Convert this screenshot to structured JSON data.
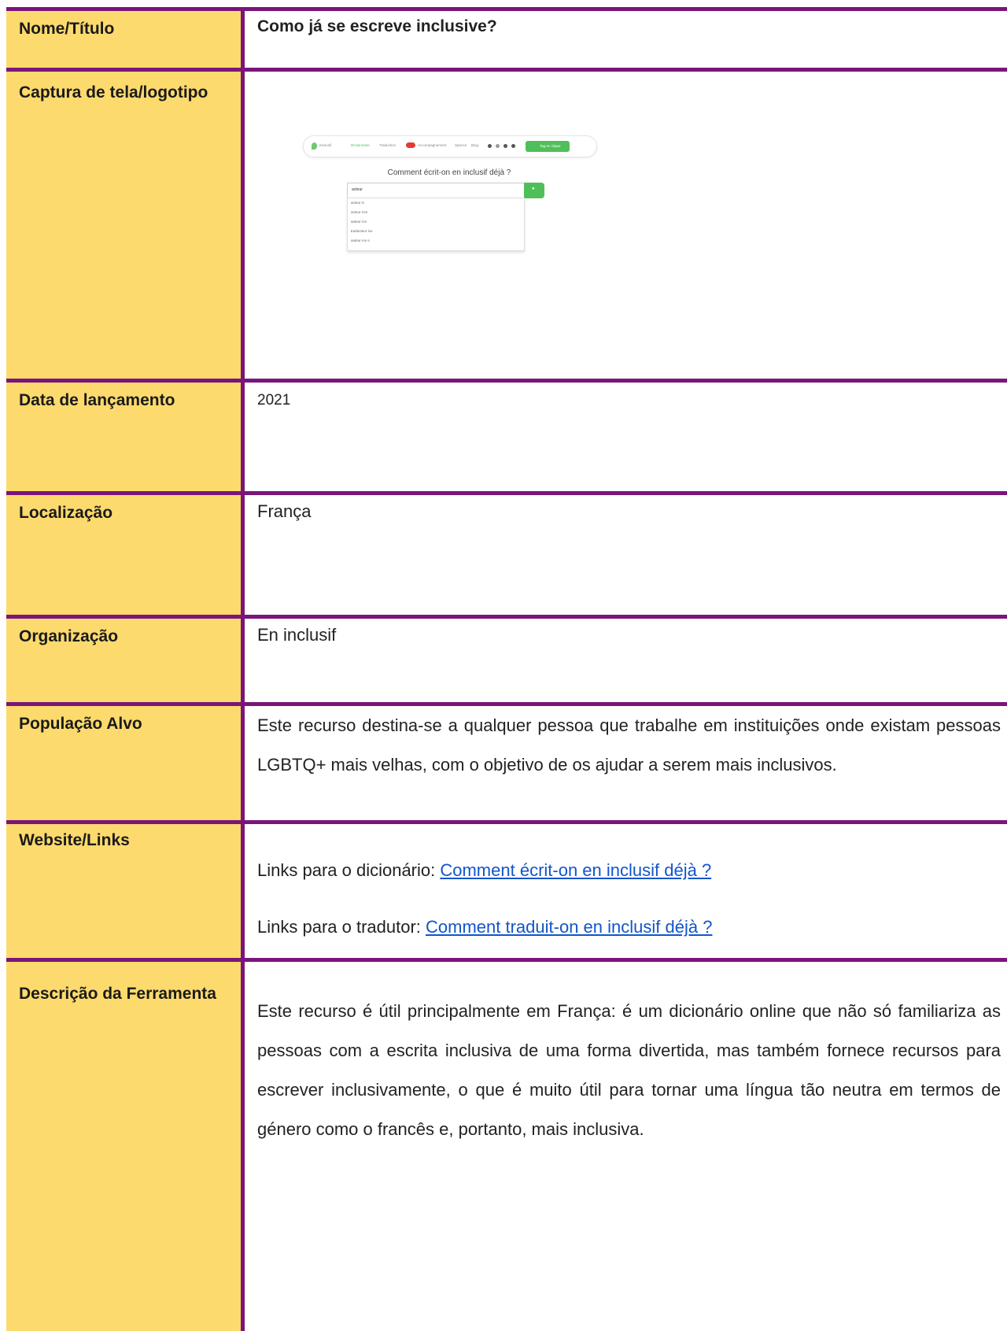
{
  "rows": {
    "title": {
      "label": "Nome/Título",
      "value": "Como já se escreve inclusive?"
    },
    "screenshot": {
      "label": "Captura de tela/logotipo",
      "preview": {
        "brand": "enclusif",
        "nav": [
          "Dictionnaire",
          "Traduction",
          "Accompagnement",
          "Spence",
          "Blog"
        ],
        "badge": "New",
        "cta": "Tag en clique",
        "heading": "Comment écrit-on en inclusif déjà ?",
        "search_value": "acteur",
        "search_icon": "search-icon",
        "suggestions": [
          "acteur·ic",
          "acteur·rice",
          "auteur·ice",
          "traducteur·ice",
          "auteur·ice·s"
        ]
      }
    },
    "date": {
      "label": "Data de lançamento",
      "value": "2021"
    },
    "location": {
      "label": "Localização",
      "value": "França"
    },
    "organization": {
      "label": "Organização",
      "value": "En inclusif"
    },
    "target": {
      "label": "População Alvo",
      "value": "Este recurso destina-se a qualquer pessoa que trabalhe em instituições onde existam pessoas LGBTQ+ mais velhas, com o objetivo de os ajudar a serem mais inclusivos."
    },
    "links": {
      "label": "Website/Links",
      "dict_prefix": "Links para o dicionário: ",
      "dict_link": "Comment écrit-on en inclusif déjà ?",
      "trans_prefix": "Links para o tradutor: ",
      "trans_link": "Comment traduit-on en inclusif déjà ?"
    },
    "description": {
      "label": "Descrição da Ferramenta",
      "value": "Este recurso é útil principalmente em França: é um dicionário online que não só familiariza as pessoas com a escrita inclusiva de uma forma divertida, mas também fornece recursos para escrever inclusivamente, o que é muito útil para tornar uma língua tão neutra em termos de género como o francês e, portanto, mais inclusiva."
    }
  },
  "colors": {
    "label_bg": "#fdda6d",
    "border": "#7a157a",
    "link": "#1155cc"
  }
}
